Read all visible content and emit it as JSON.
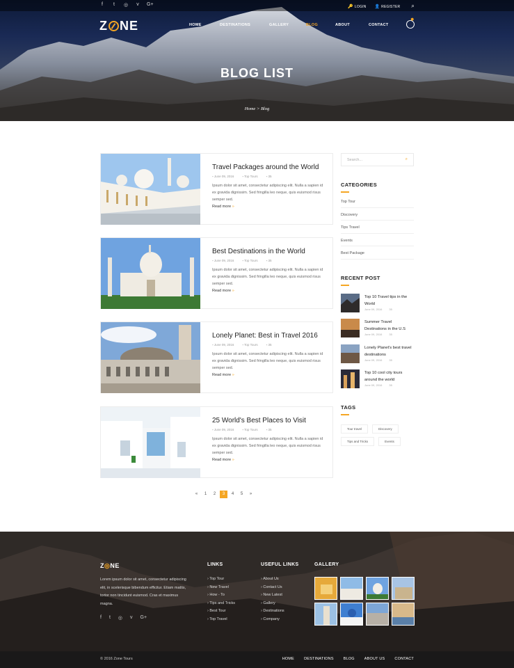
{
  "topbar": {
    "social_icons": [
      "facebook-icon",
      "twitter-icon",
      "instagram-icon",
      "vimeo-icon",
      "google-plus-icon"
    ],
    "social_glyphs": [
      "f",
      "t",
      "◎",
      "v",
      "G+"
    ],
    "login": "LOGIN",
    "register": "REGISTER"
  },
  "header": {
    "logo_left": "Z",
    "logo_right": "NE",
    "nav": [
      "HOME",
      "DESTINATIONS",
      "GALLERY",
      "BLOG",
      "ABOUT",
      "CONTACT"
    ],
    "active_nav": "BLOG",
    "title": "BLOG LIST",
    "breadcrumb": "Home > Blog"
  },
  "posts": [
    {
      "title": "Travel Packages around the World",
      "date": "June 09, 2016",
      "category": "Top Tours",
      "comments": "35",
      "excerpt": "Ipsum dolor sit amet, consectetur adipiscing elit. Nulla a sapien id ex gravida dignissim. Sed fringilla leo neque, quis euismod risus semper sed.",
      "readmore": "Read more"
    },
    {
      "title": "Best Destinations in the World",
      "date": "June 09, 2016",
      "category": "Top Tours",
      "comments": "35",
      "excerpt": "Ipsum dolor sit amet, consectetur adipiscing elit. Nulla a sapien id ex gravida dignissim. Sed fringilla leo neque, quis euismod risus semper sed.",
      "readmore": "Read more"
    },
    {
      "title": "Lonely Planet: Best in Travel 2016",
      "date": "June 09, 2016",
      "category": "Top Tours",
      "comments": "35",
      "excerpt": "Ipsum dolor sit amet, consectetur adipiscing elit. Nulla a sapien id ex gravida dignissim. Sed fringilla leo neque, quis euismod risus semper sed.",
      "readmore": "Read more"
    },
    {
      "title": "25 World's Best Places to Visit",
      "date": "June 09, 2016",
      "category": "Top Tours",
      "comments": "35",
      "excerpt": "Ipsum dolor sit amet, consectetur adipiscing elit. Nulla a sapien id ex gravida dignissim. Sed fringilla leo neque, quis euismod risus semper sed.",
      "readmore": "Read more"
    }
  ],
  "pagination": {
    "prev": "«",
    "pages": [
      "1",
      "2",
      "3",
      "4",
      "5"
    ],
    "current": "3",
    "next": "»"
  },
  "sidebar": {
    "search_placeholder": "Search...",
    "categories_title": "CATEGORIES",
    "categories": [
      "Top Tour",
      "Discovery",
      "Tips Travel",
      "Events",
      "Best Package"
    ],
    "recent_title": "RECENT POST",
    "recent": [
      {
        "title": "Top 10 Travel tips in the World",
        "date": "June 09, 2016",
        "comments": "35"
      },
      {
        "title": "Summer Travel Destinations in the U.S",
        "date": "June 09, 2016",
        "comments": "35"
      },
      {
        "title": "Lonely Planet's best travel destinations",
        "date": "June 09, 2016",
        "comments": "35"
      },
      {
        "title": "Top 10 cool city tours around the world",
        "date": "June 09, 2016",
        "comments": "35"
      }
    ],
    "tags_title": "TAGS",
    "tags": [
      "Tour travel",
      "Discovery",
      "Tips and Tricks",
      "Events"
    ]
  },
  "footer": {
    "logo_left": "Z",
    "logo_right": "NE",
    "about": "Lorem ipsum dolor sit amet, consectetur adipiscing elit, in scelerisque bibendum efficitur. Etiam mattis, tortor non tincidunt euismod. Cras et maximus magna.",
    "links_title": "LINKS",
    "links": [
      "Top Tour",
      "New Travel",
      "How - To",
      "Tips and Tricks",
      "Best Tour",
      "Top Travel"
    ],
    "useful_title": "USEFUL LINKS",
    "useful": [
      "About Us",
      "Contact Us",
      "New Latest",
      "Gallery",
      "Destinations",
      "Company"
    ],
    "gallery_title": "GALLERY",
    "copyright": "© 2016 Zone Tours",
    "bottom_nav": [
      "HOME",
      "DESTINATIONS",
      "BLOG",
      "ABOUT US",
      "CONTACT"
    ]
  },
  "colors": {
    "accent": "#f5a623",
    "dark": "#1a1919"
  }
}
